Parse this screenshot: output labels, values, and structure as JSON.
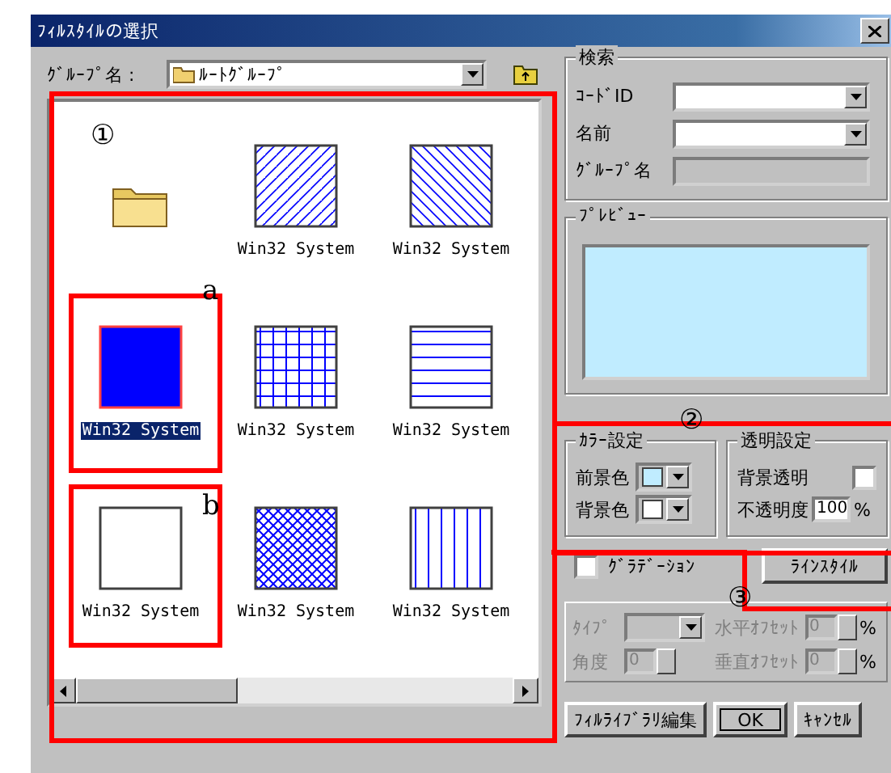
{
  "window": {
    "title": "ﾌｨﾙｽﾀｲﾙの選択"
  },
  "group": {
    "label": "ｸﾞﾙｰﾌﾟ名 :",
    "value": "ﾙｰﾄｸﾞﾙｰﾌﾟ"
  },
  "items": [
    {
      "kind": "folder",
      "selected": false
    },
    {
      "kind": "updiagonal",
      "label": "Win32 System",
      "selected": false
    },
    {
      "kind": "downdiagonal",
      "label": "Win32 System",
      "selected": false
    },
    {
      "kind": "solid",
      "label": "Win32 System",
      "selected": true
    },
    {
      "kind": "cross",
      "label": "Win32 System",
      "selected": false
    },
    {
      "kind": "horizontal",
      "label": "Win32 System",
      "selected": false
    },
    {
      "kind": "empty",
      "label": "Win32 System",
      "selected": false
    },
    {
      "kind": "diagcross",
      "label": "Win32 System",
      "selected": false
    },
    {
      "kind": "vertical",
      "label": "Win32 System",
      "selected": false
    }
  ],
  "search": {
    "title": "検索",
    "fields": [
      {
        "label": "ｺｰﾄﾞID",
        "kind": "combo"
      },
      {
        "label": "名前",
        "kind": "combo"
      },
      {
        "label": "ｸﾞﾙｰﾌﾟ名",
        "kind": "readonly"
      }
    ]
  },
  "preview": {
    "title": "ﾌﾟﾚﾋﾞｭｰ"
  },
  "color_settings": {
    "title": "ｶﾗｰ設定",
    "items": [
      {
        "label": "前景色",
        "color": "#c0ecff"
      },
      {
        "label": "背景色",
        "color": "#ffffff"
      }
    ]
  },
  "transparency": {
    "title": "透明設定",
    "background_transparent": {
      "label": "背景透明",
      "checked": false
    },
    "opacity": {
      "label": "不透明度",
      "value": "100",
      "unit": "%"
    }
  },
  "gradation": {
    "label": "ｸﾞﾗﾃﾞｰｼｮﾝ",
    "checked": false,
    "fields": [
      {
        "label": "ﾀｲﾌﾟ",
        "kind": "combo",
        "disabled": true
      },
      {
        "label": "水平ｵﾌｾｯﾄ",
        "kind": "spin",
        "value": "0",
        "unit": "%",
        "disabled": true
      },
      {
        "label": "角度",
        "kind": "spin",
        "value": "0",
        "disabled": true
      },
      {
        "label": "垂直ｵﾌｾｯﾄ",
        "kind": "spin",
        "value": "0",
        "unit": "%",
        "disabled": true
      }
    ]
  },
  "line_style_button": "ﾗｲﾝｽﾀｲﾙ",
  "buttons": [
    {
      "label": "ﾌｨﾙﾗｲﾌﾞﾗﾘ編集",
      "default": false
    },
    {
      "label": "OK",
      "default": true
    },
    {
      "label": "ｷｬﾝｾﾙ",
      "default": false
    }
  ],
  "annotations": [
    {
      "label": "①"
    },
    {
      "label": "②"
    },
    {
      "label": "③"
    },
    {
      "label": "a"
    },
    {
      "label": "b"
    }
  ]
}
